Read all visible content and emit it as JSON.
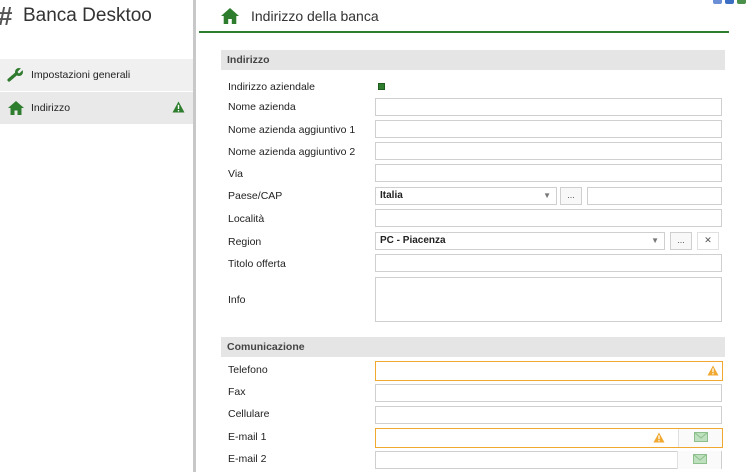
{
  "app": {
    "hash": "#",
    "name": "Banca Desktoo"
  },
  "sidebar": {
    "items": [
      {
        "label": "Impostazioni generali",
        "icon": "wrench-icon"
      },
      {
        "label": "Indirizzo",
        "icon": "home-icon",
        "status": "warning-icon"
      }
    ]
  },
  "header": {
    "title": "Indirizzo della banca",
    "icon": "home-icon"
  },
  "sections": {
    "indirizzo": "Indirizzo",
    "comunicazione": "Comunicazione"
  },
  "fields": {
    "indirizzo_aziendale": {
      "label": "Indirizzo aziendale",
      "checked": true
    },
    "nome_azienda": {
      "label": "Nome azienda",
      "value": ""
    },
    "nome_azienda_agg1": {
      "label": "Nome azienda aggiuntivo 1",
      "value": ""
    },
    "nome_azienda_agg2": {
      "label": "Nome azienda aggiuntivo 2",
      "value": ""
    },
    "via": {
      "label": "Via",
      "value": ""
    },
    "paese_cap": {
      "label": "Paese/CAP",
      "value": "Italia",
      "browse": "...",
      "cap": ""
    },
    "localita": {
      "label": "Località",
      "value": ""
    },
    "region": {
      "label": "Region",
      "value": "PC - Piacenza",
      "browse": "...",
      "clear": "✕"
    },
    "titolo_offerta": {
      "label": "Titolo offerta",
      "value": ""
    },
    "info": {
      "label": "Info",
      "value": ""
    },
    "telefono": {
      "label": "Telefono",
      "value": "",
      "status": "warning"
    },
    "fax": {
      "label": "Fax",
      "value": ""
    },
    "cellulare": {
      "label": "Cellulare",
      "value": ""
    },
    "email1": {
      "label": "E-mail 1",
      "value": "",
      "status": "warning"
    },
    "email2": {
      "label": "E-mail 2",
      "value": ""
    }
  },
  "colors": {
    "accent": "#2e7d2e",
    "warning": "#f0a830",
    "section_bg": "#e5e5e5"
  }
}
